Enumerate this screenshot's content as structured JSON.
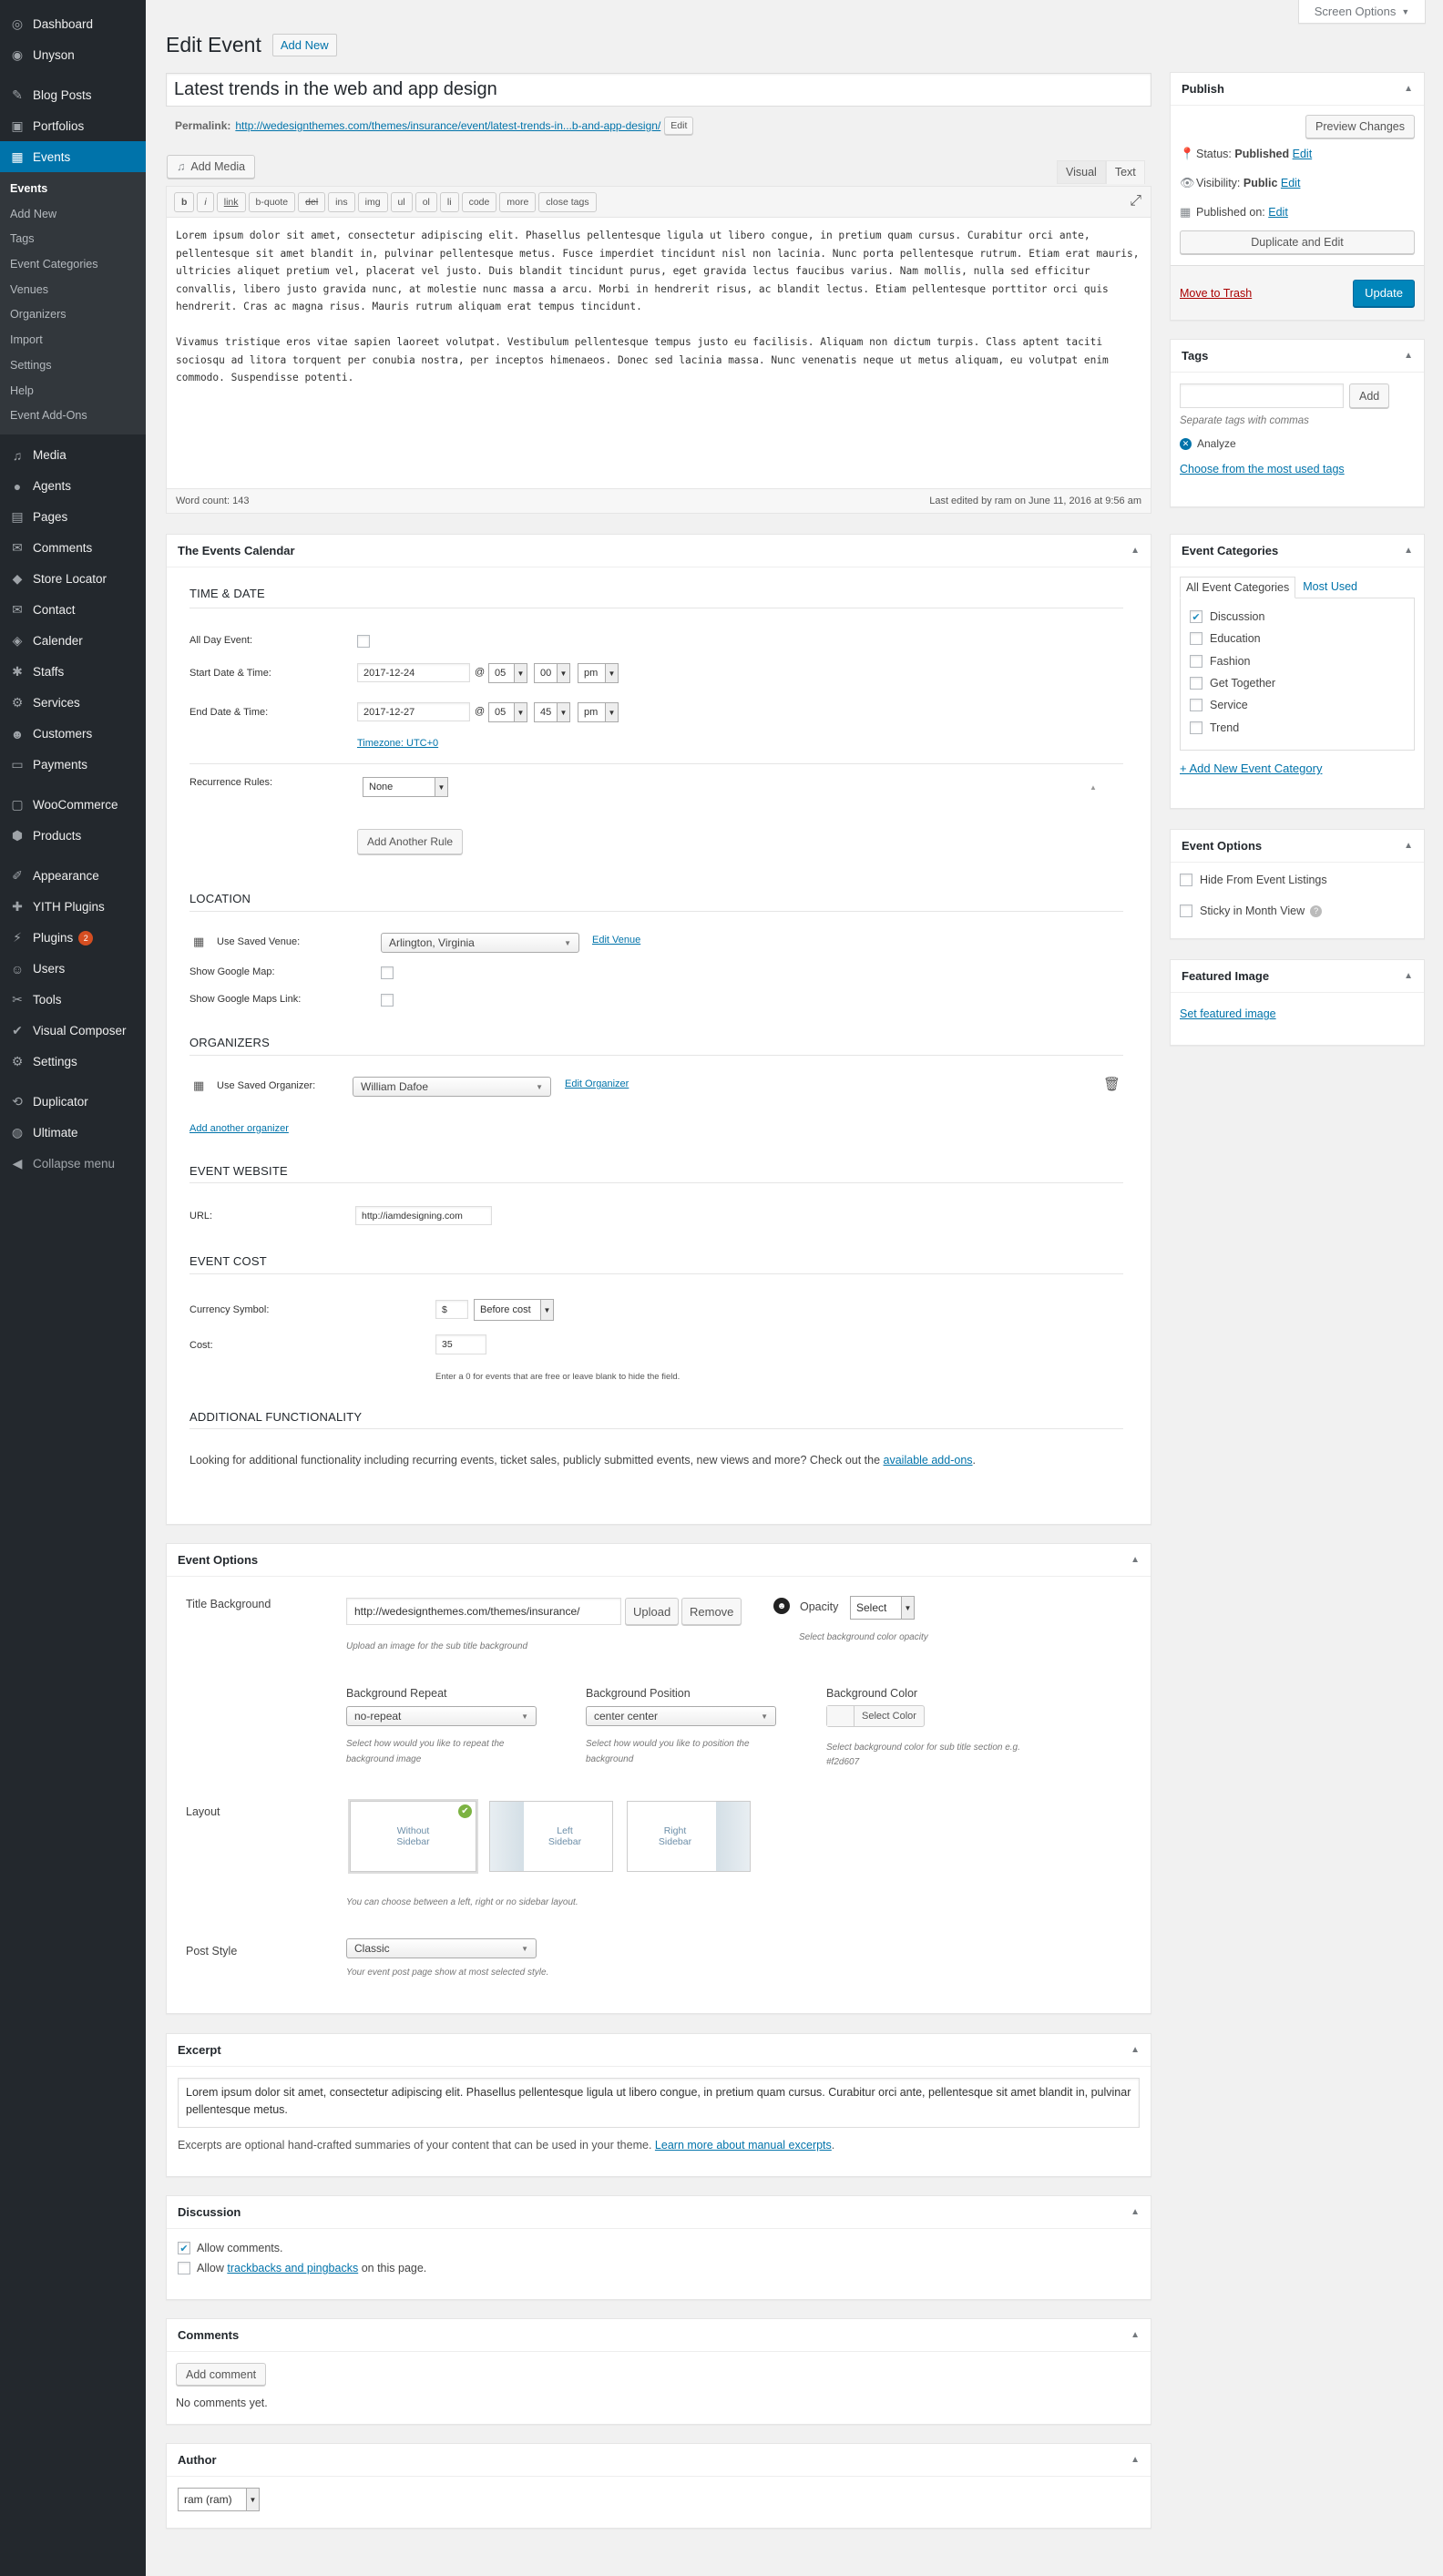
{
  "screen_options": "Screen Options",
  "page": {
    "title": "Edit Event",
    "add_new": "Add New"
  },
  "sidebar": {
    "top": [
      {
        "label": "Dashboard",
        "icon": "dashboard-icon",
        "glyph": "◎"
      },
      {
        "label": "Unyson",
        "icon": "unyson-icon",
        "glyph": "◉"
      }
    ],
    "group2": [
      {
        "label": "Blog Posts",
        "icon": "pin-icon",
        "glyph": "✎"
      },
      {
        "label": "Portfolios",
        "icon": "portfolio-icon",
        "glyph": "▣"
      },
      {
        "label": "Events",
        "icon": "calendar-icon",
        "glyph": "▦"
      }
    ],
    "events_submenu": [
      "Events",
      "Add New",
      "Tags",
      "Event Categories",
      "Venues",
      "Organizers",
      "Import",
      "Settings",
      "Help",
      "Event Add-Ons"
    ],
    "group3": [
      {
        "label": "Media",
        "icon": "media-icon",
        "glyph": "♫"
      },
      {
        "label": "Agents",
        "icon": "agents-icon",
        "glyph": "●"
      },
      {
        "label": "Pages",
        "icon": "pages-icon",
        "glyph": "▤"
      },
      {
        "label": "Comments",
        "icon": "comments-icon",
        "glyph": "✉"
      },
      {
        "label": "Store Locator",
        "icon": "location-icon",
        "glyph": "◆"
      },
      {
        "label": "Contact",
        "icon": "contact-icon",
        "glyph": "✉"
      },
      {
        "label": "Calender",
        "icon": "calender-icon",
        "glyph": "◈"
      },
      {
        "label": "Staffs",
        "icon": "staffs-icon",
        "glyph": "✱"
      },
      {
        "label": "Services",
        "icon": "services-icon",
        "glyph": "⚙"
      },
      {
        "label": "Customers",
        "icon": "customers-icon",
        "glyph": "☻"
      },
      {
        "label": "Payments",
        "icon": "payments-icon",
        "glyph": "▭"
      }
    ],
    "group4": [
      {
        "label": "WooCommerce",
        "icon": "woocommerce-icon",
        "glyph": "▢"
      },
      {
        "label": "Products",
        "icon": "products-icon",
        "glyph": "⬢"
      }
    ],
    "group5": [
      {
        "label": "Appearance",
        "icon": "appearance-icon",
        "glyph": "✐"
      },
      {
        "label": "YITH Plugins",
        "icon": "yith-icon",
        "glyph": "✚"
      },
      {
        "label": "Plugins",
        "icon": "plugins-icon",
        "glyph": "⚡",
        "badge": "2"
      },
      {
        "label": "Users",
        "icon": "users-icon",
        "glyph": "☺"
      },
      {
        "label": "Tools",
        "icon": "tools-icon",
        "glyph": "✂"
      },
      {
        "label": "Visual Composer",
        "icon": "visual-composer-icon",
        "glyph": "✔"
      },
      {
        "label": "Settings",
        "icon": "settings-icon",
        "glyph": "⚙"
      }
    ],
    "group6": [
      {
        "label": "Duplicator",
        "icon": "duplicator-icon",
        "glyph": "⟲"
      },
      {
        "label": "Ultimate",
        "icon": "ultimate-icon",
        "glyph": "◍"
      }
    ],
    "collapse": "Collapse menu"
  },
  "editor": {
    "title": "Latest trends in the web and app design",
    "permalink_label": "Permalink:",
    "permalink_url": "http://wedesignthemes.com/themes/insurance/event/latest-trends-in...b-and-app-design/",
    "permalink_edit": "Edit",
    "add_media": "Add Media",
    "tab_visual": "Visual",
    "tab_text": "Text",
    "quicktags": [
      "b",
      "i",
      "link",
      "b-quote",
      "del",
      "ins",
      "img",
      "ul",
      "ol",
      "li",
      "code",
      "more",
      "close tags"
    ],
    "paragraph1": "Lorem ipsum dolor sit amet, consectetur adipiscing elit. Phasellus pellentesque ligula ut libero congue, in pretium quam cursus. Curabitur orci ante, pellentesque sit amet blandit in, pulvinar pellentesque metus. Fusce imperdiet tincidunt nisl non lacinia. Nunc porta pellentesque rutrum. Etiam erat mauris, ultricies aliquet pretium vel, placerat vel justo. Duis blandit tincidunt purus, eget gravida lectus faucibus varius. Nam mollis, nulla sed efficitur convallis, libero justo gravida nunc, at molestie nunc massa a arcu. Morbi in hendrerit risus, ac blandit lectus. Etiam pellentesque porttitor orci quis hendrerit. Cras ac magna risus. Mauris rutrum aliquam erat tempus tincidunt.",
    "paragraph2": "Vivamus tristique eros vitae sapien laoreet volutpat. Vestibulum pellentesque tempus justo eu facilisis. Aliquam non dictum turpis. Class aptent taciti sociosqu ad litora torquent per conubia nostra, per inceptos himenaeos. Donec sed lacinia massa. Nunc venenatis neque ut metus aliquam, eu volutpat enim commodo. Suspendisse potenti.",
    "word_count": "Word count: 143",
    "last_edited": "Last edited by ram on June 11, 2016 at 9:56 am"
  },
  "events_calendar": {
    "title": "The Events Calendar",
    "time_date": "TIME & DATE",
    "all_day": "All Day Event:",
    "start_label": "Start Date & Time:",
    "start_date": "2017-12-24",
    "start_hour": "05",
    "start_min": "00",
    "start_ampm": "pm",
    "end_label": "End Date & Time:",
    "end_date": "2017-12-27",
    "end_hour": "05",
    "end_min": "45",
    "end_ampm": "pm",
    "at": "@",
    "timezone": "Timezone: UTC+0",
    "recurrence_label": "Recurrence Rules:",
    "recurrence_value": "None",
    "add_rule": "Add Another Rule",
    "location": "LOCATION",
    "use_saved_venue": "Use Saved Venue:",
    "venue_value": "Arlington, Virginia",
    "edit_venue": "Edit Venue",
    "show_map": "Show Google Map:",
    "show_map_link": "Show Google Maps Link:",
    "organizers": "ORGANIZERS",
    "use_saved_organizer": "Use Saved Organizer:",
    "organizer_value": "William Dafoe",
    "edit_organizer": "Edit Organizer",
    "add_organizer": "Add another organizer",
    "website": "EVENT WEBSITE",
    "url_label": "URL:",
    "url_value": "http://iamdesigning.com",
    "cost": "EVENT COST",
    "currency_label": "Currency Symbol:",
    "currency_value": "$",
    "currency_position": "Before cost",
    "cost_label": "Cost:",
    "cost_value": "35",
    "cost_hint": "Enter a 0 for events that are free or leave blank to hide the field.",
    "additional": "ADDITIONAL FUNCTIONALITY",
    "additional_text": "Looking for additional functionality including recurring events, ticket sales, publicly submitted events, new views and more? Check out the",
    "addons_link": "available add-ons",
    "addons_tail": "."
  },
  "event_options_main": {
    "title": "Event Options",
    "title_bg_label": "Title Background",
    "title_bg_value": "http://wedesignthemes.com/themes/insurance/",
    "upload": "Upload",
    "remove": "Remove",
    "upload_hint": "Upload an image for the sub title background",
    "opacity_label": "Opacity",
    "opacity_value": "Select",
    "opacity_hint": "Select background color opacity",
    "bg_repeat_label": "Background Repeat",
    "bg_repeat_value": "no-repeat",
    "bg_repeat_hint": "Select how would you like to repeat the background image",
    "bg_position_label": "Background Position",
    "bg_position_value": "center center",
    "bg_position_hint": "Select how would you like to position the background",
    "bg_color_label": "Background Color",
    "bg_color_btn": "Select Color",
    "bg_color_hint": "Select background color for sub title section e.g. #f2d607",
    "layout_label": "Layout",
    "layout_opts": [
      "Without Sidebar",
      "Left Sidebar",
      "Right Sidebar"
    ],
    "layout_hint": "You can choose between a left, right or no sidebar layout.",
    "post_style_label": "Post Style",
    "post_style_value": "Classic",
    "post_style_hint": "Your event post page show at most selected style."
  },
  "excerpt": {
    "title": "Excerpt",
    "text": "Lorem ipsum dolor sit amet, consectetur adipiscing elit. Phasellus pellentesque ligula ut libero congue, in pretium quam cursus. Curabitur orci ante, pellentesque sit amet blandit in, pulvinar pellentesque metus.",
    "help": "Excerpts are optional hand-crafted summaries of your content that can be used in your theme.",
    "help_link": "Learn more about manual excerpts",
    "help_tail": "."
  },
  "discussion": {
    "title": "Discussion",
    "allow_comments": "Allow comments.",
    "allow_pre": "Allow",
    "trackbacks_link": "trackbacks and pingbacks",
    "allow_post": "on this page."
  },
  "comments": {
    "title": "Comments",
    "add": "Add comment",
    "none": "No comments yet."
  },
  "author": {
    "title": "Author",
    "value": "ram (ram)"
  },
  "publish": {
    "title": "Publish",
    "preview": "Preview Changes",
    "status_label": "Status:",
    "status_value": "Published",
    "visibility_label": "Visibility:",
    "visibility_value": "Public",
    "published_label": "Published on:",
    "edit": "Edit",
    "duplicate": "Duplicate and Edit",
    "trash": "Move to Trash",
    "update": "Update"
  },
  "tags": {
    "title": "Tags",
    "add": "Add",
    "hint": "Separate tags with commas",
    "tag": "Analyze",
    "choose": "Choose from the most used tags"
  },
  "event_categories": {
    "title": "Event Categories",
    "tab_all": "All Event Categories",
    "tab_used": "Most Used",
    "items": [
      {
        "label": "Discussion",
        "checked": true
      },
      {
        "label": "Education",
        "checked": false
      },
      {
        "label": "Fashion",
        "checked": false
      },
      {
        "label": "Get Together",
        "checked": false
      },
      {
        "label": "Service",
        "checked": false
      },
      {
        "label": "Trend",
        "checked": false
      }
    ],
    "add_new": "+ Add New Event Category"
  },
  "event_options_side": {
    "title": "Event Options",
    "hide": "Hide From Event Listings",
    "sticky": "Sticky in Month View"
  },
  "featured_image": {
    "title": "Featured Image",
    "set": "Set featured image"
  },
  "colors": {
    "accent": "#0073aa",
    "sidebar": "#23282d",
    "primary_button": "#0085ba",
    "trash": "#a00"
  }
}
